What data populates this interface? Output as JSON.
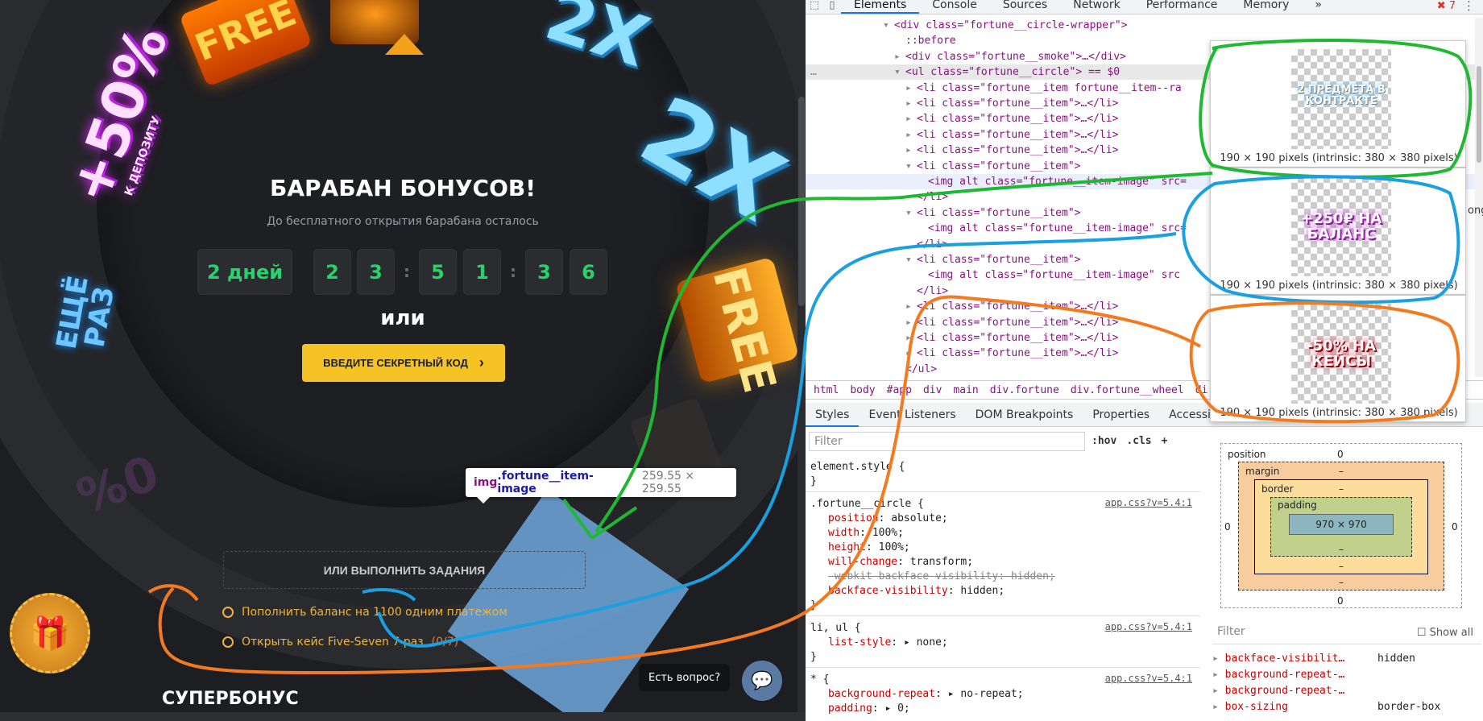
{
  "site": {
    "prizes": {
      "free_label": "FREE",
      "two_x": "2X",
      "plus50": "+50%",
      "plus50_sub": "К ДЕПОЗИТУ",
      "again": "ЕЩЁ РАЗ",
      "ghost": "0%"
    },
    "title": "БАРАБАН БОНУСОВ!",
    "subtitle": "До бесплатного открытия барабана осталось",
    "timer": {
      "days": "2 дней",
      "digits": [
        "2",
        "3",
        "5",
        "1",
        "3",
        "6"
      ],
      "separator": ":"
    },
    "or_label": "или",
    "secret_button": "ВВЕДИТЕ СЕКРЕТНЫЙ КОД",
    "secret_chevron": "›",
    "tasks_button": "ИЛИ ВЫПОЛНИТЬ ЗАДАНИЯ",
    "tasks": [
      {
        "text": "Пополнить баланс на 1100 одним платежом",
        "progress": ""
      },
      {
        "text": "Открыть кейс Five-Seven 7 раз",
        "progress": "(0/7)"
      }
    ],
    "gift_icon": "🎁",
    "superbonus": "СУПЕРБОНУС",
    "question": "Есть вопрос?",
    "chat_icon": "💬",
    "tooltip": {
      "tag": "img",
      "cls": ".fortune__item-image",
      "size": "259.55 × 259.55"
    }
  },
  "devtools": {
    "tabs": [
      "Elements",
      "Console",
      "Sources",
      "Network",
      "Performance",
      "Memory"
    ],
    "tabs_more": "»",
    "errors": "✖ 7",
    "more": "⋮",
    "dom_lines": [
      {
        "tri": "▾",
        "html": "<div class=\"fortune__circle-wrapper\">"
      },
      {
        "tri": "",
        "html": "::before"
      },
      {
        "tri": "▸",
        "html": "<div class=\"fortune__smoke\">…</div>"
      },
      {
        "tri": "▾",
        "html": "<ul class=\"fortune__circle\"> == $0"
      },
      {
        "tri": "▸",
        "html": "<li class=\"fortune__item fortune__item--ra"
      },
      {
        "tri": "▸",
        "html": "<li class=\"fortune__item\">…</li>"
      },
      {
        "tri": "▸",
        "html": "<li class=\"fortune__item\">…</li>"
      },
      {
        "tri": "▸",
        "html": "<li class=\"fortune__item\">…</li>"
      },
      {
        "tri": "▸",
        "html": "<li class=\"fortune__item\">…</li>"
      },
      {
        "tri": "▾",
        "html": "<li class=\"fortune__item\">"
      },
      {
        "tri": "",
        "html": "<img alt class=\"fortune__item-image\" src="
      },
      {
        "tri": "",
        "html": "</li>"
      },
      {
        "tri": "▾",
        "html": "<li class=\"fortune__item\">"
      },
      {
        "tri": "",
        "html": "<img alt class=\"fortune__item-image\" src="
      },
      {
        "tri": "",
        "html": "</li>"
      },
      {
        "tri": "▾",
        "html": "<li class=\"fortune__item\">"
      },
      {
        "tri": "",
        "html": "<img alt class=\"fortune__item-image\" src"
      },
      {
        "tri": "",
        "html": "</li>"
      },
      {
        "tri": "▸",
        "html": "<li class=\"fortune__item\">…</li>"
      },
      {
        "tri": "▸",
        "html": "<li class=\"fortune__item\">…</li>"
      },
      {
        "tri": "▸",
        "html": "<li class=\"fortune__item\">…</li>"
      },
      {
        "tri": "▸",
        "html": "<li class=\"fortune__item\">…</li>"
      },
      {
        "tri": "",
        "html": "</ul>"
      }
    ],
    "ellipsis": "…",
    "crumbs": [
      "html",
      "body",
      "#app",
      "div",
      "main",
      "div.fortune",
      "div.fortune__wheel",
      "di"
    ],
    "panel_tabs": [
      "Styles",
      "Event Listeners",
      "DOM Breakpoints",
      "Properties",
      "Accessibility"
    ],
    "filter_placeholder": "Filter",
    "hov": ":hov",
    "cls": ".cls",
    "plus": "+",
    "styles": {
      "element_style": "element.style {",
      "close": "}",
      "rule1_sel": ".fortune__circle {",
      "rule1_src": "app.css?v=5.4:1",
      "rule1": [
        {
          "p": "position",
          "v": "absolute;"
        },
        {
          "p": "width",
          "v": "100%;"
        },
        {
          "p": "height",
          "v": "100%;"
        },
        {
          "p": "will-change",
          "v": "transform;"
        },
        {
          "p": "-webkit-backface-visibility",
          "v": "hidden;"
        },
        {
          "p": "backface-visibility",
          "v": "hidden;"
        }
      ],
      "rule2_sel": "li, ul {",
      "rule2_src": "app.css?v=5.4:1",
      "rule2_prop": "list-style",
      "rule2_val": "▸ none;",
      "rule3_sel": "* {",
      "rule3_src": "app.css?v=5.4:1",
      "rule3": [
        {
          "p": "background-repeat",
          "v": "▸ no-repeat;"
        },
        {
          "p": "padding",
          "v": "▸ 0;"
        }
      ]
    },
    "box": {
      "position": "position",
      "margin": "margin",
      "border": "border",
      "padding": "padding",
      "content": "970 × 970",
      "zero": "0",
      "dash": "–"
    },
    "computed_filter": "Filter",
    "show_all": "Show all",
    "computed": [
      {
        "p": "backface-visibilit…",
        "v": "hidden"
      },
      {
        "p": "background-repeat-…",
        "v": ""
      },
      {
        "p": "background-repeat-…",
        "v": ""
      },
      {
        "p": "box-sizing",
        "v": "border-box"
      }
    ],
    "previews": [
      {
        "art": "2 ПРЕДМЕТА В КОНТРАКТЕ",
        "caption": "190 × 190 pixels (intrinsic: 380 × 380 pixels)",
        "color": "#2fa6ff"
      },
      {
        "art": "+250₽ НА БАЛАНС",
        "caption": "190 × 190 pixels (intrinsic: 380 × 380 pixels)",
        "color": "#c22cd9"
      },
      {
        "art": "-50% НА КЕЙСЫ",
        "caption": "190 × 190 pixels (intrinsic: 380 × 380 pixels)",
        "color": "#e0213a"
      }
    ],
    "side_text": "ong"
  },
  "annotation_colors": {
    "green": "#1fb832",
    "blue": "#1a9fe0",
    "orange": "#f47a20"
  }
}
